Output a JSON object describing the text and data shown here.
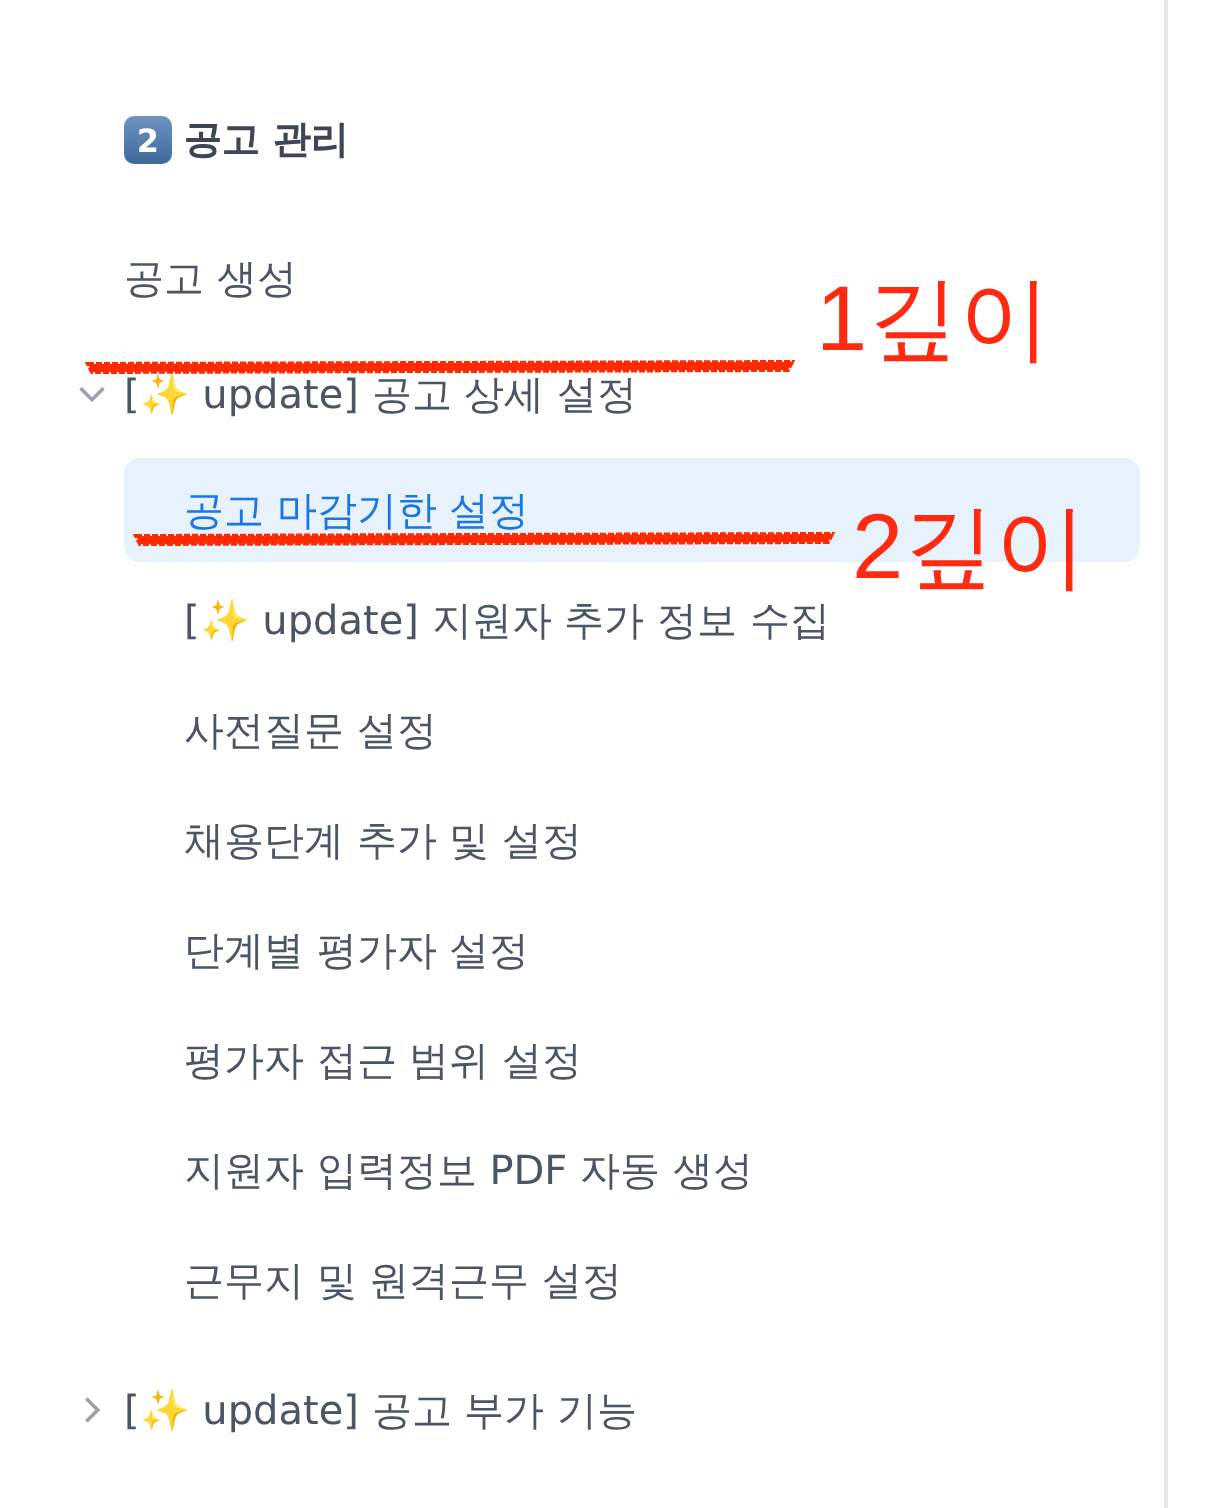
{
  "heading": {
    "badge": "2",
    "label": "공고 관리"
  },
  "items": [
    {
      "kind": "link",
      "label": "공고 생성"
    },
    {
      "kind": "group",
      "label": "[✨ update] 공고 상세 설정",
      "expanded": true,
      "children": [
        {
          "label": "공고 마감기한 설정",
          "selected": true
        },
        {
          "label": "[✨ update] 지원자 추가 정보 수집",
          "selected": false
        },
        {
          "label": "사전질문 설정",
          "selected": false
        },
        {
          "label": "채용단계 추가 및 설정",
          "selected": false
        },
        {
          "label": "단계별 평가자 설정",
          "selected": false
        },
        {
          "label": "평가자 접근 범위 설정",
          "selected": false
        },
        {
          "label": "지원자 입력정보 PDF 자동 생성",
          "selected": false
        },
        {
          "label": "근무지 및 원격근무 설정",
          "selected": false
        }
      ]
    },
    {
      "kind": "group",
      "label": "[✨ update] 공고 부가 기능",
      "expanded": false
    }
  ],
  "annotations": [
    {
      "text": "1깊이"
    },
    {
      "text": "2깊이"
    }
  ]
}
